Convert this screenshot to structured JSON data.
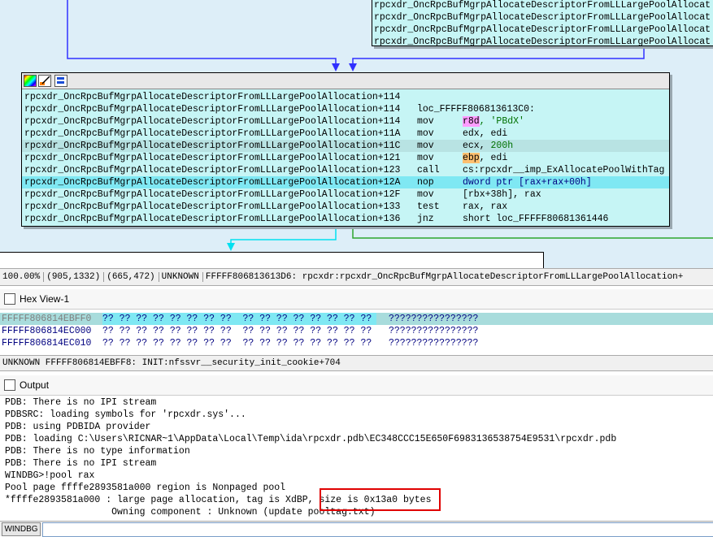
{
  "graph": {
    "top_node_rows": [
      "rpcxdr_OncRpcBufMgrpAllocateDescriptorFromLLLargePoolAllocat",
      "rpcxdr_OncRpcBufMgrpAllocateDescriptorFromLLLargePoolAllocat",
      "rpcxdr_OncRpcBufMgrpAllocateDescriptorFromLLLargePoolAllocat",
      "rpcxdr_OncRpcBufMgrpAllocateDescriptorFromLLLargePoolAllocat"
    ],
    "main_node_rows": [
      {
        "addr": "rpcxdr_OncRpcBufMgrpAllocateDescriptorFromLLLargePoolAllocation+114",
        "mn": "",
        "op": ""
      },
      {
        "addr": "rpcxdr_OncRpcBufMgrpAllocateDescriptorFromLLLargePoolAllocation+114",
        "mn": "loc_FFFFF806813613C0:",
        "op": ""
      },
      {
        "addr": "rpcxdr_OncRpcBufMgrpAllocateDescriptorFromLLLargePoolAllocation+114",
        "mn": "mov",
        "op_reg": "r8d",
        "op_rest": ", 'PBdX'"
      },
      {
        "addr": "rpcxdr_OncRpcBufMgrpAllocateDescriptorFromLLLargePoolAllocation+11A",
        "mn": "mov",
        "op": "edx, edi"
      },
      {
        "addr": "rpcxdr_OncRpcBufMgrpAllocateDescriptorFromLLLargePoolAllocation+11C",
        "mn": "mov",
        "op_pre": "ecx, ",
        "op_green": "200h"
      },
      {
        "addr": "rpcxdr_OncRpcBufMgrpAllocateDescriptorFromLLLargePoolAllocation+121",
        "mn": "mov",
        "op_reg": "ebp",
        "op_rest": ", edi"
      },
      {
        "addr": "rpcxdr_OncRpcBufMgrpAllocateDescriptorFromLLLargePoolAllocation+123",
        "mn": "call",
        "op": "cs:rpcxdr__imp_ExAllocatePoolWithTag"
      },
      {
        "addr": "rpcxdr_OncRpcBufMgrpAllocateDescriptorFromLLLargePoolAllocation+12A",
        "mn": "nop",
        "op": "dword ptr [rax+rax+00h]"
      },
      {
        "addr": "rpcxdr_OncRpcBufMgrpAllocateDescriptorFromLLLargePoolAllocation+12F",
        "mn": "mov",
        "op": "[rbx+38h], rax"
      },
      {
        "addr": "rpcxdr_OncRpcBufMgrpAllocateDescriptorFromLLLargePoolAllocation+133",
        "mn": "test",
        "op": "rax, rax"
      },
      {
        "addr": "rpcxdr_OncRpcBufMgrpAllocateDescriptorFromLLLargePoolAllocation+136",
        "mn": "jnz",
        "op": "short loc_FFFFF80681361446"
      }
    ]
  },
  "graph_status": {
    "zoom": "100.00%",
    "coords": "(905,1332)",
    "mouse": "(665,472)",
    "kind": "UNKNOWN",
    "location": "FFFFF806813613D6: rpcxdr:rpcxdr_OncRpcBufMgrpAllocateDescriptorFromLLLargePoolAllocation+"
  },
  "hex_view": {
    "title": "Hex View-1",
    "rows": [
      {
        "addr": "FFFFF806814EBFF0",
        "bytes": "?? ?? ?? ?? ?? ?? ?? ??  ?? ?? ?? ?? ?? ?? ?? ??",
        "ascii": "????????????????"
      },
      {
        "addr": "FFFFF806814EC000",
        "bytes": "?? ?? ?? ?? ?? ?? ?? ??  ?? ?? ?? ?? ?? ?? ?? ??",
        "ascii": "????????????????"
      },
      {
        "addr": "FFFFF806814EC010",
        "bytes": "?? ?? ?? ?? ?? ?? ?? ??  ?? ?? ?? ?? ?? ?? ?? ??",
        "ascii": "????????????????"
      }
    ],
    "status": "UNKNOWN FFFFF806814EBFF8: INIT:nfssvr__security_init_cookie+704"
  },
  "output": {
    "title": "Output",
    "lines": [
      "PDB: There is no IPI stream",
      "PDBSRC: loading symbols for 'rpcxdr.sys'...",
      "PDB: using PDBIDA provider",
      "PDB: loading C:\\Users\\RICNAR~1\\AppData\\Local\\Temp\\ida\\rpcxdr.pdb\\EC348CCC15E650F6983136538754E9531\\rpcxdr.pdb",
      "PDB: There is no type information",
      "PDB: There is no IPI stream",
      "WINDBG>!pool rax",
      "Pool page ffffe2893581a000 region is Nonpaged pool",
      "*ffffe2893581a000 : large page allocation, tag is XdBP, size is 0x13a0 bytes",
      "                   Owning component : Unknown (update pooltag.txt)"
    ]
  },
  "command_bar": {
    "button_label": "WINDBG",
    "input_value": ""
  },
  "colors": {
    "graph_bg": "#ddeef8",
    "node_bg": "#c6f5f5",
    "selected_line": "#7fe8f3",
    "edge_blue": "#3030ff",
    "edge_cyan": "#00e0f0",
    "edge_green": "#2ea62e",
    "highlight_box": "#e00000"
  }
}
